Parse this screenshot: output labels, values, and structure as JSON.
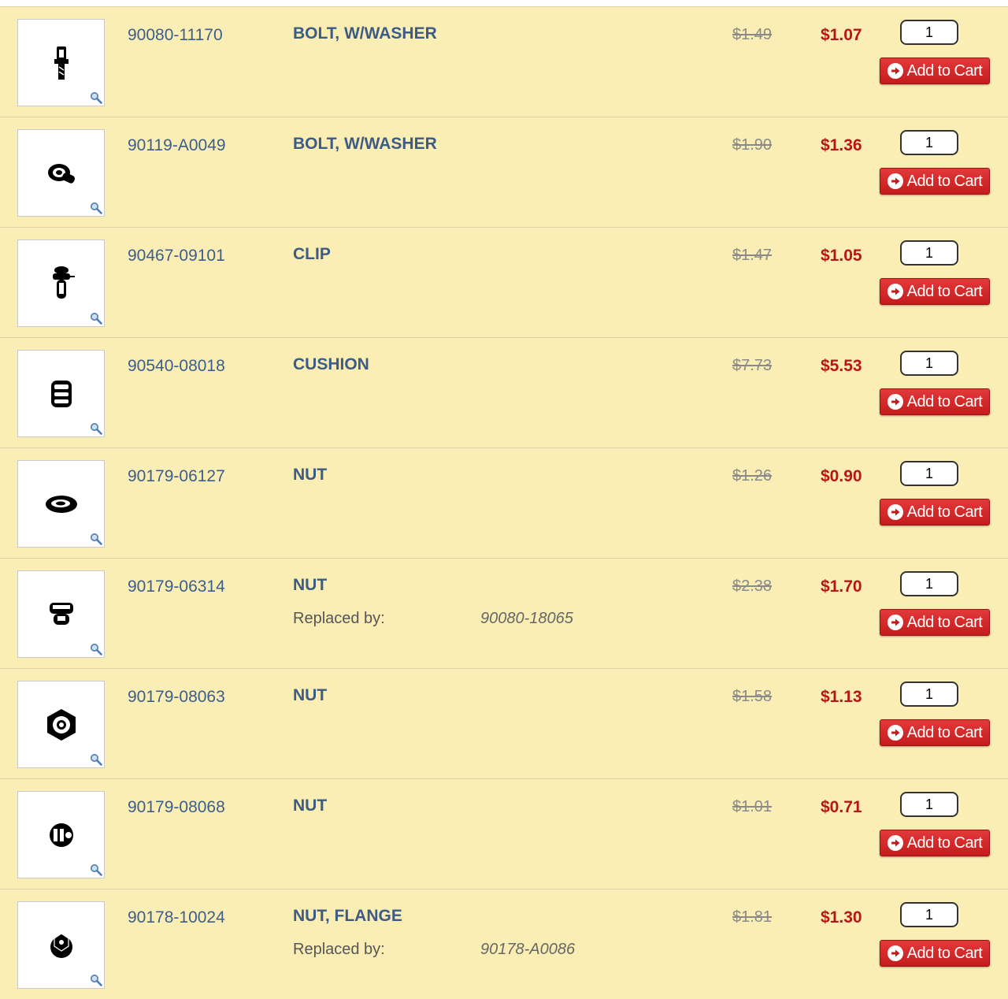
{
  "colors": {
    "row_bg": "#fbeeb5",
    "part_number": "#3b5e8c",
    "description": "#3c5b85",
    "sale_price": "#b81616",
    "msrp": "#8a8a8a",
    "cart_button": "#d42b2b"
  },
  "icons": {
    "zoom": "magnifier-icon",
    "cart": "arrow-circle-right-icon"
  },
  "labels": {
    "add_to_cart": "Add to Cart",
    "replaced_by": "Replaced by:"
  },
  "parts": [
    {
      "part_number": "90080-11170",
      "description": "BOLT, W/WASHER",
      "msrp": "$1.49",
      "price": "$1.07",
      "qty": "1",
      "replaced_by": "",
      "thumbnail": "bolt"
    },
    {
      "part_number": "90119-A0049",
      "description": "BOLT, W/WASHER",
      "msrp": "$1.90",
      "price": "$1.36",
      "qty": "1",
      "replaced_by": "",
      "thumbnail": "bolt-side"
    },
    {
      "part_number": "90467-09101",
      "description": "CLIP",
      "msrp": "$1.47",
      "price": "$1.05",
      "qty": "1",
      "replaced_by": "",
      "thumbnail": "clip"
    },
    {
      "part_number": "90540-08018",
      "description": "CUSHION",
      "msrp": "$7.73",
      "price": "$5.53",
      "qty": "1",
      "replaced_by": "",
      "thumbnail": "cushion"
    },
    {
      "part_number": "90179-06127",
      "description": "NUT",
      "msrp": "$1.26",
      "price": "$0.90",
      "qty": "1",
      "replaced_by": "",
      "thumbnail": "nut-flat"
    },
    {
      "part_number": "90179-06314",
      "description": "NUT",
      "msrp": "$2.38",
      "price": "$1.70",
      "qty": "1",
      "replaced_by": "90080-18065",
      "thumbnail": "nut-cap"
    },
    {
      "part_number": "90179-08063",
      "description": "NUT",
      "msrp": "$1.58",
      "price": "$1.13",
      "qty": "1",
      "replaced_by": "",
      "thumbnail": "nut-hex"
    },
    {
      "part_number": "90179-08068",
      "description": "NUT",
      "msrp": "$1.01",
      "price": "$0.71",
      "qty": "1",
      "replaced_by": "",
      "thumbnail": "nut-round"
    },
    {
      "part_number": "90178-10024",
      "description": "NUT, FLANGE",
      "msrp": "$1.81",
      "price": "$1.30",
      "qty": "1",
      "replaced_by": "90178-A0086",
      "thumbnail": "nut-flange"
    }
  ]
}
